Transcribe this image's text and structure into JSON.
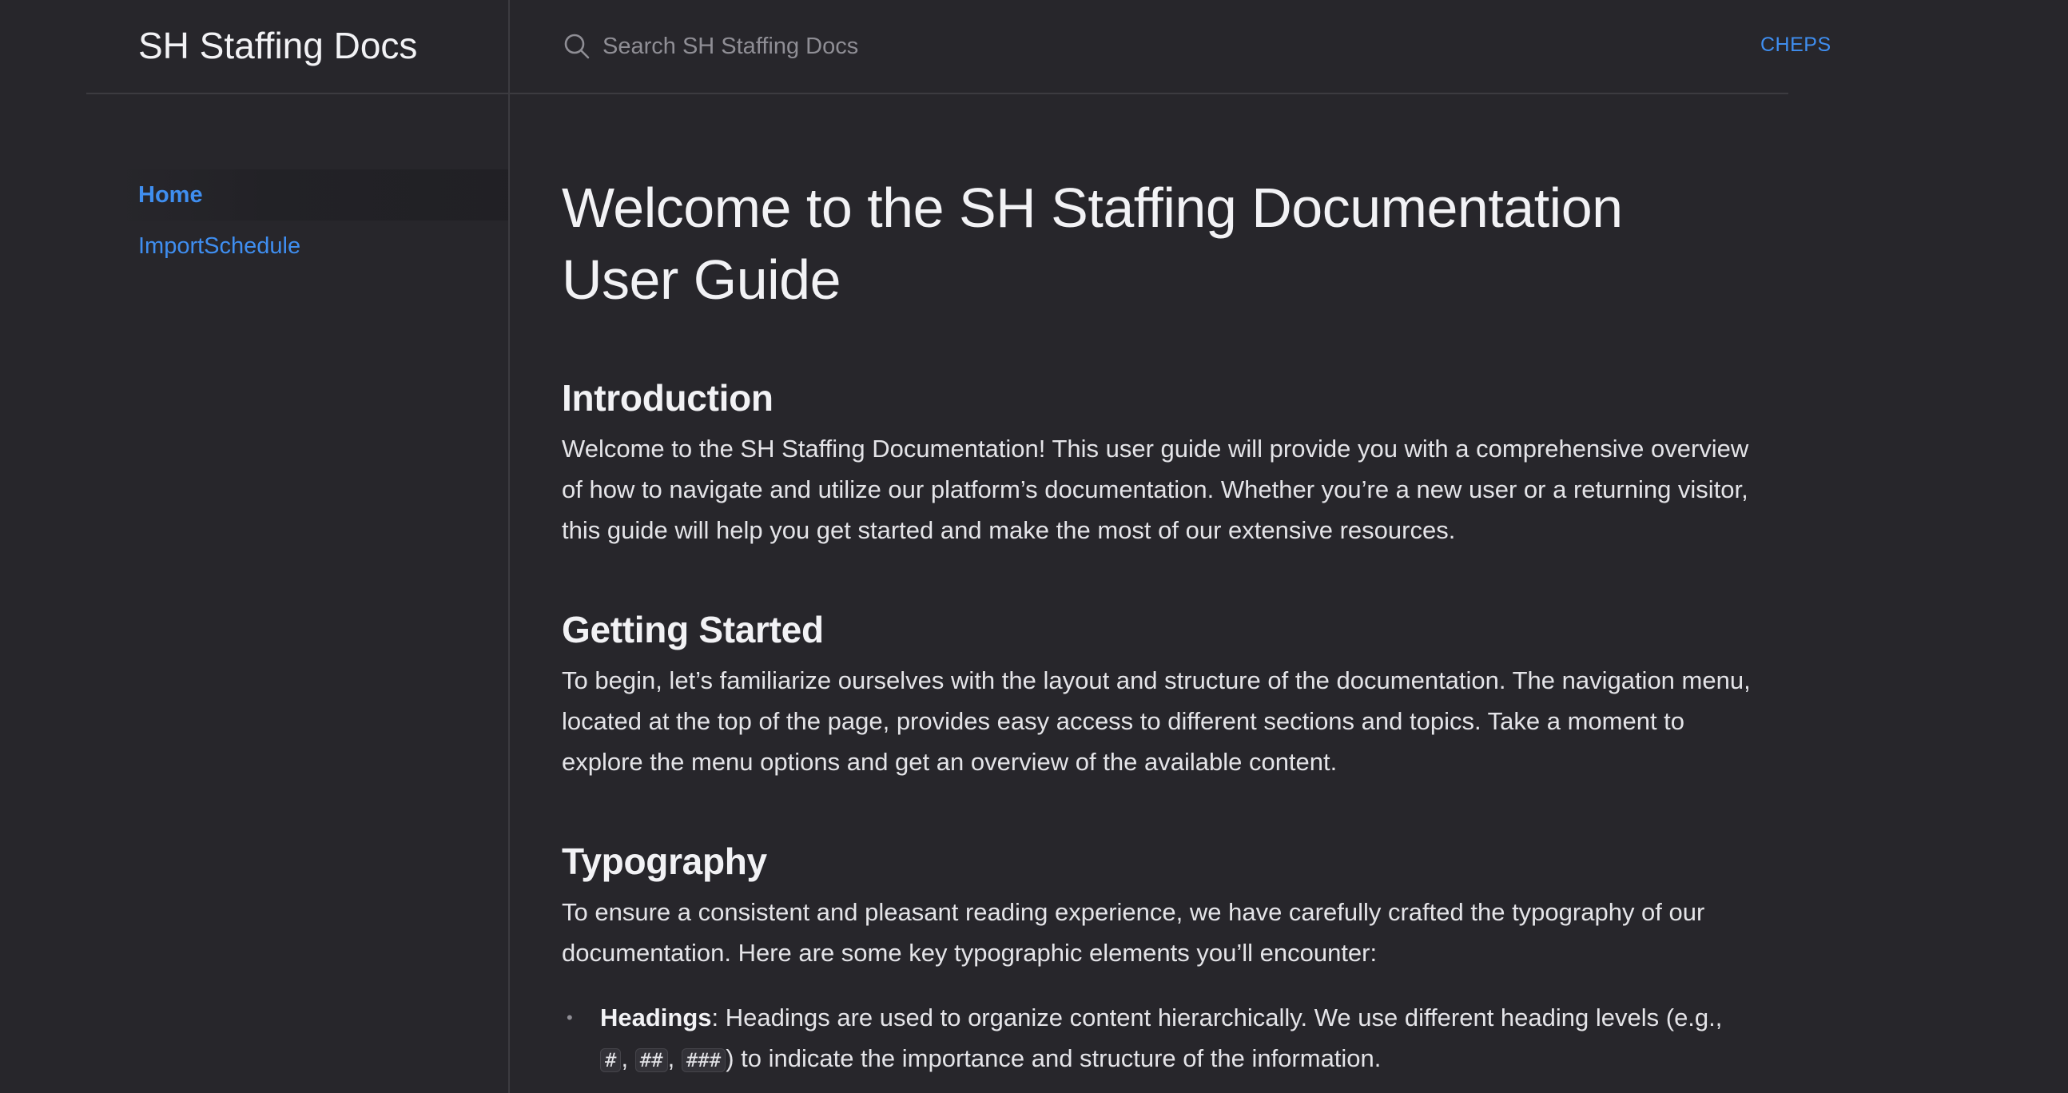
{
  "header": {
    "site_title": "SH Staffing Docs",
    "search_placeholder": "Search SH Staffing Docs",
    "aux_link": "CHEPS"
  },
  "sidebar": {
    "items": [
      {
        "label": "Home",
        "active": true
      },
      {
        "label": "ImportSchedule",
        "active": false
      }
    ]
  },
  "main": {
    "title": "Welcome to the SH Staffing Documentation User Guide",
    "sections": [
      {
        "heading": "Introduction",
        "paragraph": "Welcome to the SH Staffing Documentation! This user guide will provide you with a comprehensive overview of how to navigate and utilize our platform’s documentation. Whether you’re a new user or a returning visitor, this guide will help you get started and make the most of our extensive resources."
      },
      {
        "heading": "Getting Started",
        "paragraph": "To begin, let’s familiarize ourselves with the layout and structure of the documentation. The navigation menu, located at the top of the page, provides easy access to different sections and topics. Take a moment to explore the menu options and get an overview of the available content."
      },
      {
        "heading": "Typography",
        "paragraph": "To ensure a consistent and pleasant reading experience, we have carefully crafted the typography of our documentation. Here are some key typographic elements you’ll encounter:"
      }
    ],
    "typography_bullets": [
      {
        "term": "Headings",
        "text_before": ": Headings are used to organize content hierarchically. We use different heading levels (e.g., ",
        "codes": [
          "#",
          "##",
          "###"
        ],
        "separator": ", ",
        "text_after": ") to indicate the importance and structure of the information."
      }
    ]
  },
  "colors": {
    "background": "#27262b",
    "accent": "#3f8ef0",
    "divider": "#3c3b40"
  },
  "icons": {
    "search": "search-icon",
    "bullet": "bullet-dot"
  }
}
